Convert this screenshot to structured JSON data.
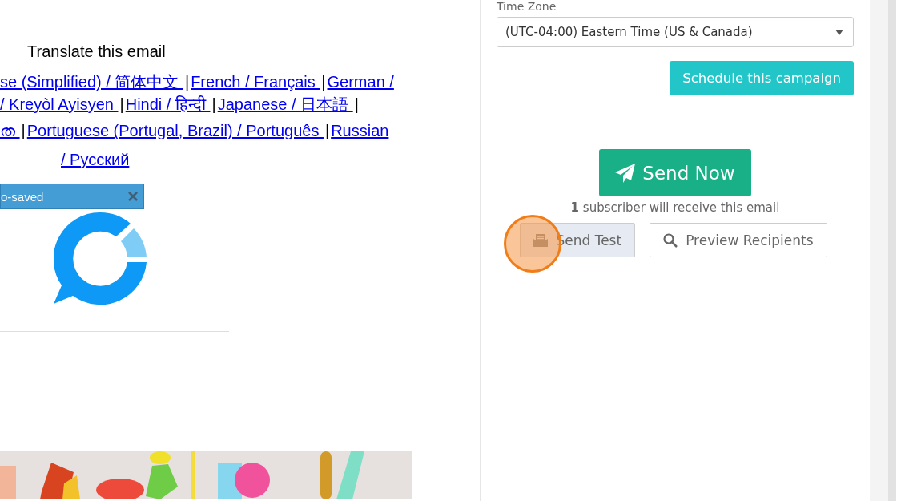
{
  "email_preview": {
    "heading": "Translate this email",
    "language_lines": [
      [
        {
          "kind": "link",
          "text": "se (Simplified) / 简体中文 "
        },
        {
          "kind": "separator",
          "text": "|"
        },
        {
          "kind": "link",
          "text": "French / Français "
        },
        {
          "kind": "separator",
          "text": "|"
        },
        {
          "kind": "link",
          "text": "German /"
        }
      ],
      [
        {
          "kind": "link",
          "text": "/ Kreyòl Ayisyen "
        },
        {
          "kind": "separator",
          "text": "|"
        },
        {
          "kind": "link",
          "text": "Hindi / हिन्दी "
        },
        {
          "kind": "separator",
          "text": "|"
        },
        {
          "kind": "link",
          "text": "Japanese / 日本語 "
        },
        {
          "kind": "separator",
          "text": "|"
        }
      ],
      [
        {
          "kind": "link",
          "text": "ത "
        },
        {
          "kind": "separator",
          "text": "|"
        },
        {
          "kind": "link",
          "text": "Portuguese (Portugal, Brazil) / Português "
        },
        {
          "kind": "separator",
          "text": "|"
        },
        {
          "kind": "link",
          "text": "Russian"
        }
      ],
      [
        {
          "kind": "link",
          "text": "/ Русский"
        }
      ]
    ],
    "toast": {
      "text": "o-saved",
      "close": "×"
    },
    "image": {
      "kind": "picture"
    }
  },
  "send_panel": {
    "time_zone": {
      "label": "Time Zone",
      "value": "(UTC-04:00) Eastern Time (US & Canada)"
    },
    "schedule_button": "Schedule this campaign",
    "send_now_button": "Send Now",
    "recipients_note": "**1** subscriber will receive this email",
    "buttons": [
      {
        "label": "Send Test",
        "kind": "test",
        "highlighted": true
      },
      {
        "label": "Preview Recipients",
        "kind": "preview",
        "highlighted": false
      }
    ]
  }
}
